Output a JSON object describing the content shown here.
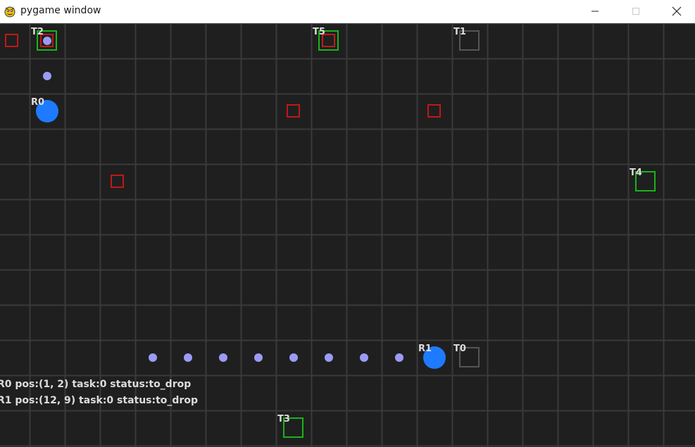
{
  "window": {
    "title": "pygame window",
    "icon": "pygame-snake-icon",
    "controls": [
      "minimize-icon",
      "maximize-icon",
      "close-icon"
    ]
  },
  "colors": {
    "background": "#1f1f1f",
    "grid_line": "#3a3a3a",
    "robot": "#1e7bff",
    "path_dot": "#9b9bf5",
    "obstacle": "#c01818",
    "task_active": "#19b419",
    "task_inactive": "#555555",
    "label": "#dcdcdc"
  },
  "grid": {
    "cols": 20,
    "rows": 12
  },
  "robots": [
    {
      "id": "R0",
      "pos": [
        1,
        2
      ]
    },
    {
      "id": "R1",
      "pos": [
        12,
        9
      ]
    }
  ],
  "tasks": [
    {
      "id": "T0",
      "pos": [
        13,
        9
      ],
      "state": "inactive"
    },
    {
      "id": "T1",
      "pos": [
        13,
        0
      ],
      "state": "inactive"
    },
    {
      "id": "T2",
      "pos": [
        1,
        0
      ],
      "state": "active"
    },
    {
      "id": "T3",
      "pos": [
        8,
        11
      ],
      "state": "active"
    },
    {
      "id": "T4",
      "pos": [
        18,
        4
      ],
      "state": "active"
    },
    {
      "id": "T5",
      "pos": [
        9,
        0
      ],
      "state": "active"
    }
  ],
  "obstacles": [
    [
      0,
      0
    ],
    [
      1,
      0
    ],
    [
      9,
      0
    ],
    [
      8,
      2
    ],
    [
      12,
      2
    ],
    [
      3,
      4
    ]
  ],
  "path_dots": [
    [
      1,
      0
    ],
    [
      1,
      1
    ],
    [
      4,
      9
    ],
    [
      5,
      9
    ],
    [
      6,
      9
    ],
    [
      7,
      9
    ],
    [
      8,
      9
    ],
    [
      9,
      9
    ],
    [
      10,
      9
    ],
    [
      11,
      9
    ]
  ],
  "status": [
    "R0 pos:(1, 2) task:0 status:to_drop",
    "R1 pos:(12, 9) task:0 status:to_drop"
  ]
}
